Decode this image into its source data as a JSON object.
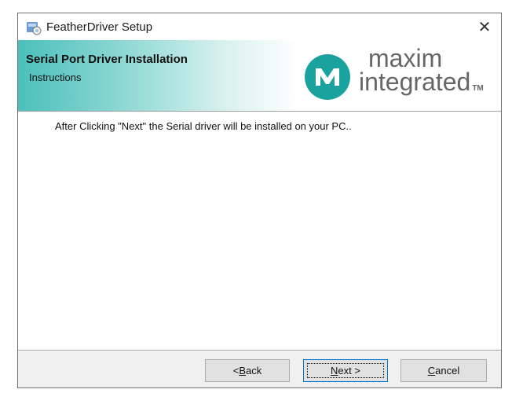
{
  "window": {
    "title": "FeatherDriver Setup",
    "close_glyph": "✕"
  },
  "banner": {
    "title": "Serial Port Driver Installation",
    "subtitle": "Instructions",
    "logo_line1": "maxim",
    "logo_line2": "integrated",
    "logo_tm": "TM",
    "logo_color": "#1aa39e"
  },
  "content": {
    "instruction": "After Clicking \"Next\" the Serial driver will be installed on your PC.."
  },
  "buttons": {
    "back_prefix": "< ",
    "back_mnemonic": "B",
    "back_rest": "ack",
    "next_mnemonic": "N",
    "next_rest": "ext >",
    "cancel_mnemonic": "C",
    "cancel_rest": "ancel"
  },
  "icons": {
    "app": "setup-package-icon",
    "close": "close-icon",
    "logo": "maxim-logo-icon"
  }
}
